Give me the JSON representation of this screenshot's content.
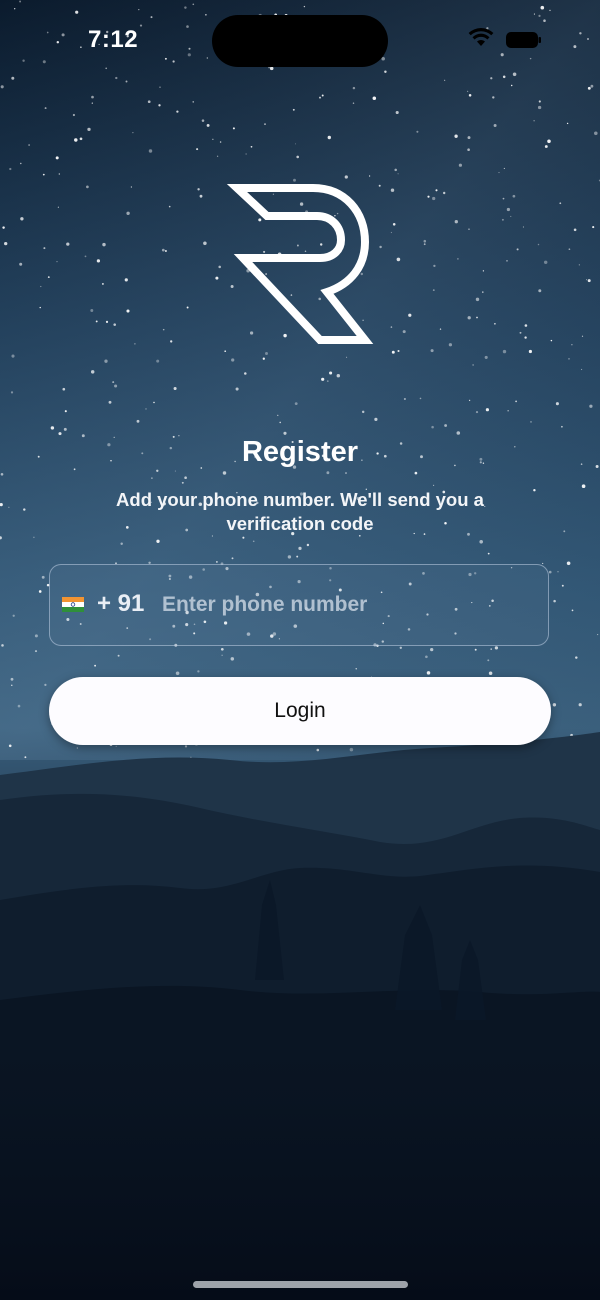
{
  "status_bar": {
    "time": "7:12",
    "wifi_icon": "wifi-icon",
    "battery_icon": "battery-icon"
  },
  "logo": {
    "icon": "r-logo-icon"
  },
  "register": {
    "title": "Register",
    "subtitle": "Add your phone number. We'll send you a verification code"
  },
  "phone": {
    "flag_icon": "india-flag-icon",
    "country_code": "+ 91",
    "placeholder": "Enter phone number",
    "value": ""
  },
  "login_button": {
    "label": "Login"
  },
  "colors": {
    "sky_top": "#0d2035",
    "sky_mid": "#2c4f6c",
    "mountain_dark": "#07101d",
    "button_bg": "#fdfcff",
    "button_text": "#111111"
  }
}
